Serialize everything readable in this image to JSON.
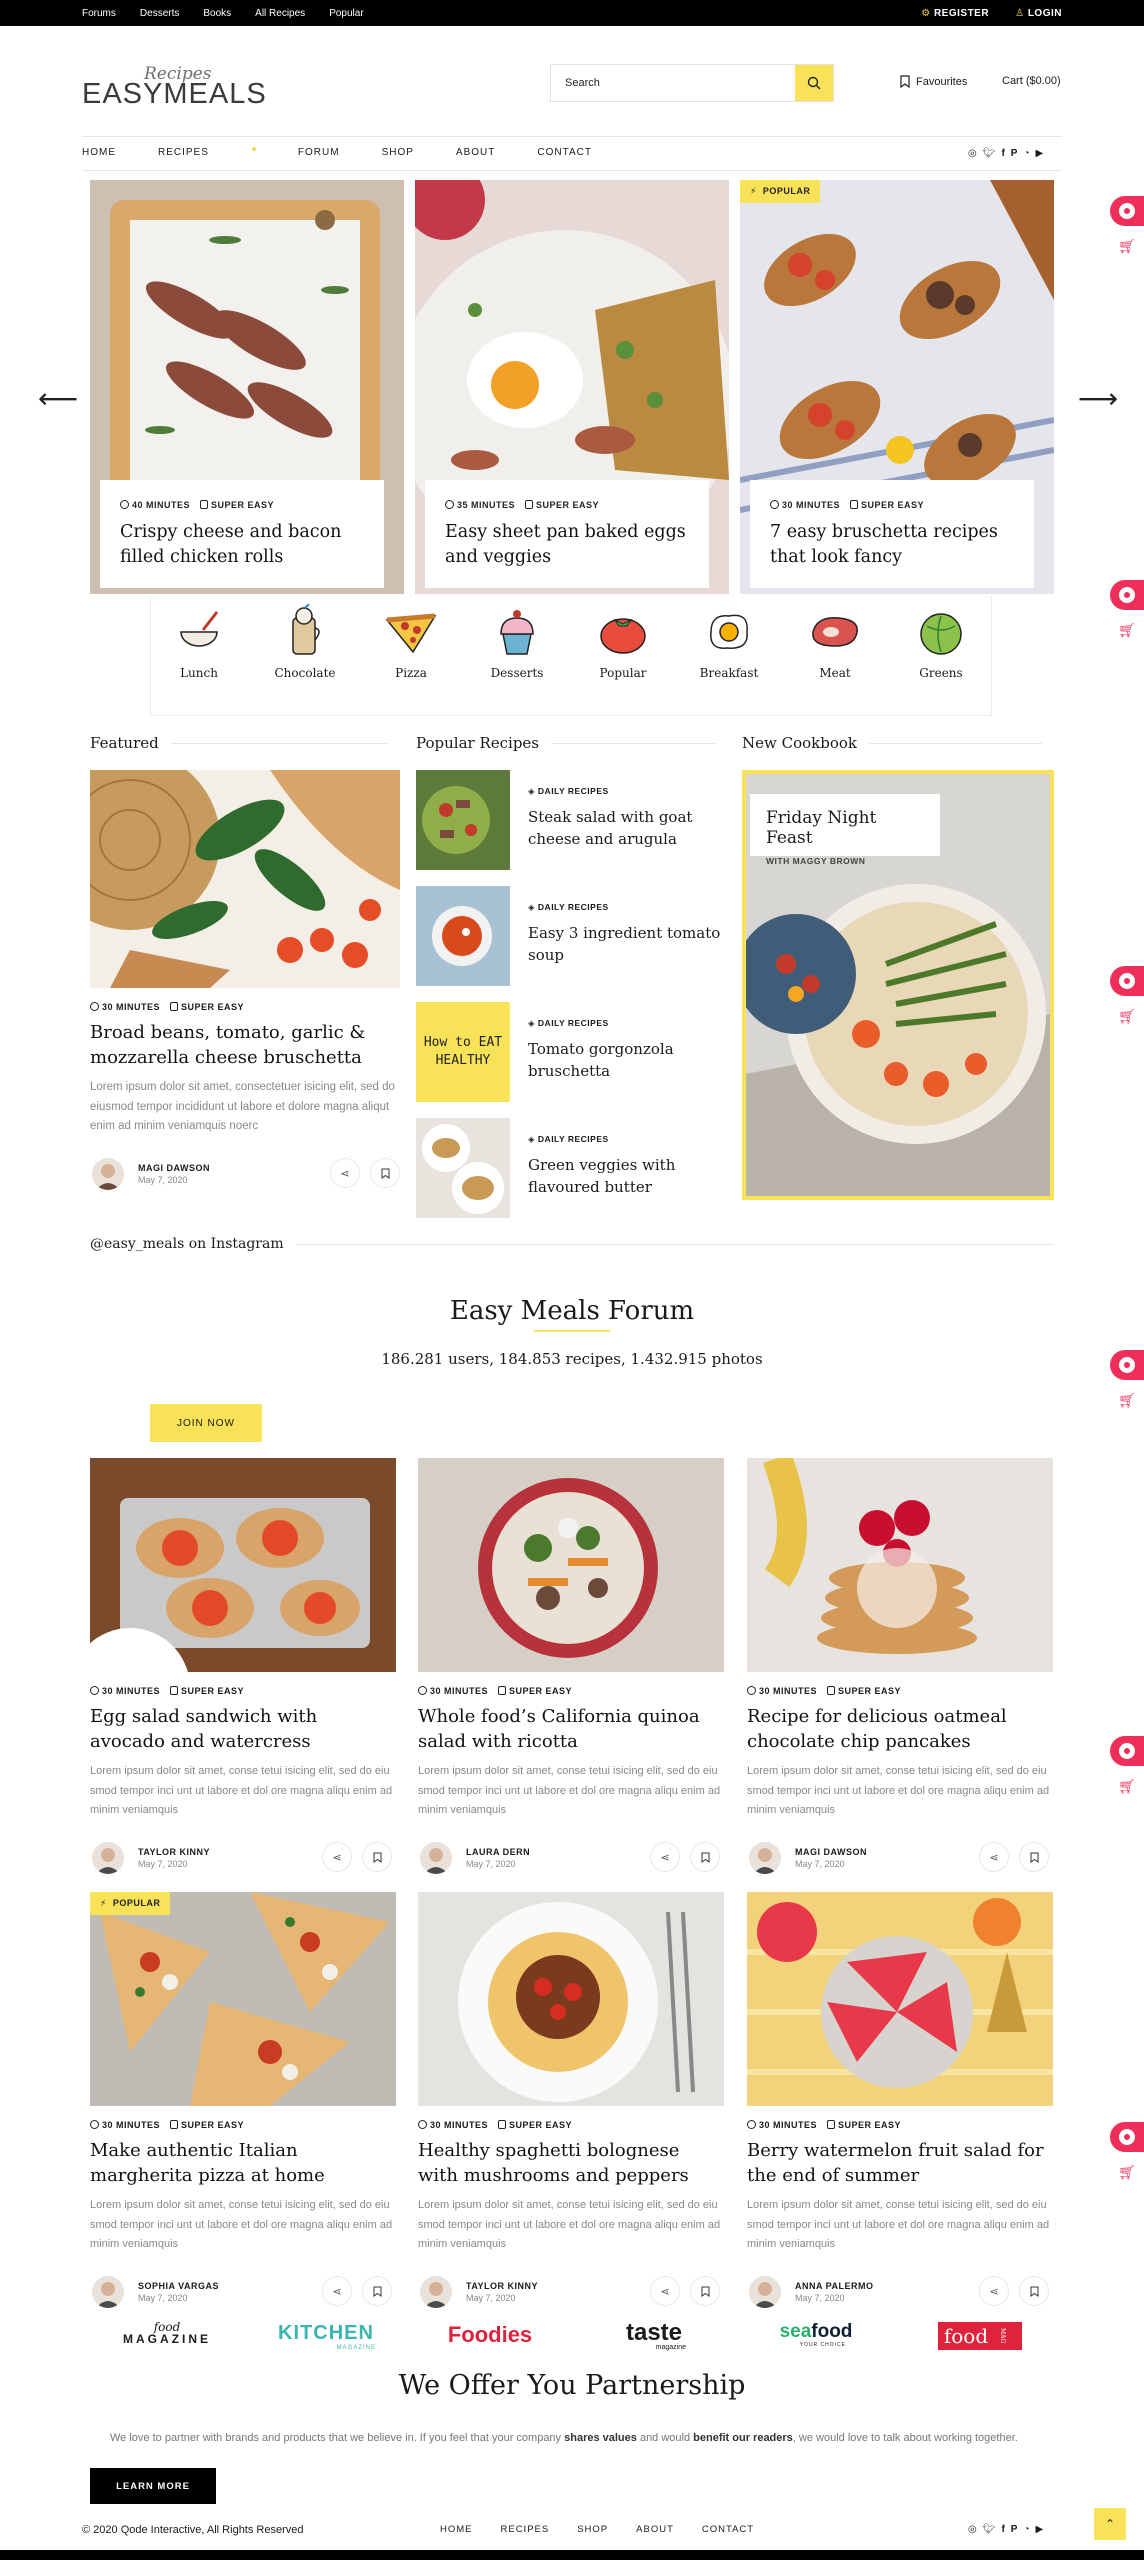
{
  "topbar": {
    "links": [
      "Forums",
      "Desserts",
      "Books",
      "All Recipes",
      "Popular"
    ],
    "register": "REGISTER",
    "login": "LOGIN"
  },
  "logo": {
    "script": "Recipes",
    "name": "EASYMEALS"
  },
  "search": {
    "placeholder": "Search"
  },
  "header": {
    "favourites": "Favourites",
    "cart": "Cart ($0.00)"
  },
  "nav": [
    "HOME",
    "RECIPES",
    "FORUM",
    "SHOP",
    "ABOUT",
    "CONTACT"
  ],
  "slider": [
    {
      "time": "40 MINUTES",
      "level": "SUPER EASY",
      "title": "Crispy cheese and bacon filled chicken rolls"
    },
    {
      "time": "35 MINUTES",
      "level": "SUPER EASY",
      "title": "Easy sheet pan baked eggs and veggies"
    },
    {
      "time": "30 MINUTES",
      "level": "SUPER EASY",
      "title": "7 easy bruschetta recipes that look fancy",
      "badge": "POPULAR"
    }
  ],
  "categories": [
    "Lunch",
    "Chocolate",
    "Pizza",
    "Desserts",
    "Popular",
    "Breakfast",
    "Meat",
    "Greens"
  ],
  "sections": {
    "featured": "Featured",
    "popular": "Popular Recipes",
    "cookbook": "New Cookbook"
  },
  "featured": {
    "time": "30 MINUTES",
    "level": "SUPER EASY",
    "title": "Broad beans, tomato, garlic & mozzarella cheese bruschetta",
    "text": "Lorem ipsum dolor sit amet, consectetuer isicing elit, sed do eiusmod tempor incididunt ut labore et dolore magna aliqut enim ad minim veniamquis noerc",
    "author": "MAGI DAWSON",
    "date": "May 7, 2020"
  },
  "popular": [
    {
      "tag": "DAILY RECIPES",
      "title": "Steak salad with goat cheese and arugula"
    },
    {
      "tag": "DAILY RECIPES",
      "title": "Easy 3 ingredient tomato soup"
    },
    {
      "tag": "DAILY RECIPES",
      "title": "Tomato gorgonzola bruschetta",
      "thumb_text": "How to EAT HEALTHY"
    },
    {
      "tag": "DAILY RECIPES",
      "title": "Green veggies with flavoured butter"
    }
  ],
  "cookbook": {
    "title": "Friday Night Feast",
    "author": "WITH MAGGY BROWN"
  },
  "instagram": "@easy_meals on Instagram",
  "forum": {
    "title": "Easy Meals Forum",
    "stats": "186.281 users, 184.853 recipes, 1.432.915 photos",
    "join": "JOIN NOW"
  },
  "grid": [
    {
      "time": "30 MINUTES",
      "level": "SUPER EASY",
      "title": "Egg salad sandwich with avocado and watercress",
      "text": "Lorem ipsum dolor sit amet, conse tetui isicing elit, sed do eiu smod tempor inci unt ut labore et dol ore magna aliqu enim ad minim veniamquis",
      "author": "TAYLOR KINNY",
      "date": "May 7, 2020"
    },
    {
      "time": "30 MINUTES",
      "level": "SUPER EASY",
      "title": "Whole food’s California quinoa salad with ricotta",
      "text": "Lorem ipsum dolor sit amet, conse tetui isicing elit, sed do eiu smod tempor inci unt ut labore et dol ore magna aliqu enim ad minim veniamquis",
      "author": "LAURA DERN",
      "date": "May 7, 2020"
    },
    {
      "time": "30 MINUTES",
      "level": "SUPER EASY",
      "title": "Recipe for delicious oatmeal chocolate chip pancakes",
      "text": "Lorem ipsum dolor sit amet, conse tetui isicing elit, sed do eiu smod tempor inci unt ut labore et dol ore magna aliqu enim ad minim veniamquis",
      "author": "MAGI DAWSON",
      "date": "May 7, 2020"
    },
    {
      "time": "30 MINUTES",
      "level": "SUPER EASY",
      "title": "Make authentic Italian margherita pizza at home",
      "text": "Lorem ipsum dolor sit amet, conse tetui isicing elit, sed do eiu smod tempor inci unt ut labore et dol ore magna aliqu enim ad minim veniamquis",
      "author": "SOPHIA VARGAS",
      "date": "May 7, 2020",
      "badge": "POPULAR"
    },
    {
      "time": "30 MINUTES",
      "level": "SUPER EASY",
      "title": "Healthy spaghetti bolognese with mushrooms and peppers",
      "text": "Lorem ipsum dolor sit amet, conse tetui isicing elit, sed do eiu smod tempor inci unt ut labore et dol ore magna aliqu enim ad minim veniamquis",
      "author": "TAYLOR KINNY",
      "date": "May 7, 2020"
    },
    {
      "time": "30 MINUTES",
      "level": "SUPER EASY",
      "title": "Berry watermelon fruit salad for the end of summer",
      "text": "Lorem ipsum dolor sit amet, conse tetui isicing elit, sed do eiu smod tempor inci unt ut labore et dol ore magna aliqu enim ad minim veniamquis",
      "author": "ANNA PALERMO",
      "date": "May 7, 2020"
    }
  ],
  "brands": [
    {
      "top": "food",
      "main": "MAGAZINE"
    },
    {
      "main": "KITCHEN",
      "sub": "MAGAZINE"
    },
    {
      "main": "Foodies"
    },
    {
      "main": "taste",
      "sub": "magazine"
    },
    {
      "main": "seafood",
      "sub": "YOUR CHOICE"
    },
    {
      "main": "food",
      "sub": "MAG"
    }
  ],
  "partner": {
    "title": "We Offer You Partnership",
    "text_a": "We love to partner with brands and products that we believe in. If you feel that your company ",
    "bold_a": "shares values",
    "text_b": " and would ",
    "bold_b": "benefit our readers",
    "text_c": ", we would love to talk about working together.",
    "button": "LEARN MORE"
  },
  "footer": {
    "copyright": "© 2020 Qode Interactive, All Rights Reserved",
    "nav": [
      "HOME",
      "RECIPES",
      "SHOP",
      "ABOUT",
      "CONTACT"
    ]
  },
  "colors": {
    "accent": "#f7e258",
    "pink": "#ef2f59",
    "dark": "#000000"
  }
}
